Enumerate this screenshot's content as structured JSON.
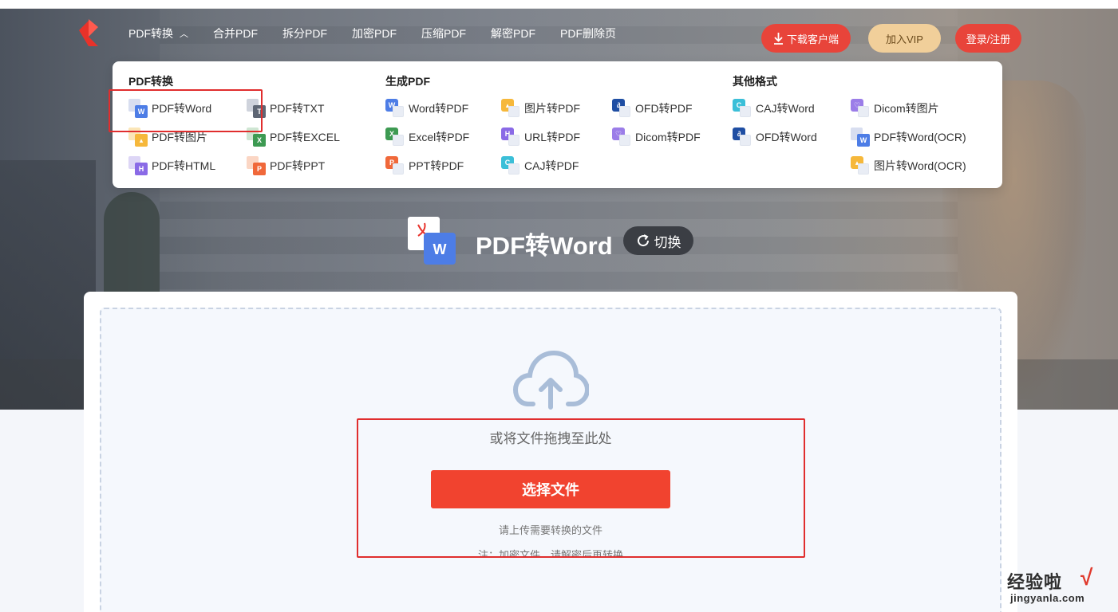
{
  "nav": {
    "items": [
      "PDF转换",
      "合并PDF",
      "拆分PDF",
      "加密PDF",
      "压缩PDF",
      "解密PDF",
      "PDF删除页"
    ],
    "download_label": "下载客户端",
    "vip_label": "加入VIP",
    "login_label": "登录/注册"
  },
  "dropdown": {
    "pdf_convert": {
      "heading": "PDF转换",
      "items": [
        "PDF转Word",
        "PDF转TXT",
        "PDF转图片",
        "PDF转EXCEL",
        "PDF转HTML",
        "PDF转PPT"
      ]
    },
    "to_pdf": {
      "heading": "生成PDF",
      "items": [
        "Word转PDF",
        "图片转PDF",
        "OFD转PDF",
        "Excel转PDF",
        "URL转PDF",
        "Dicom转PDF",
        "PPT转PDF",
        "CAJ转PDF"
      ]
    },
    "other": {
      "heading": "其他格式",
      "items": [
        "CAJ转Word",
        "Dicom转图片",
        "OFD转Word",
        "PDF转Word(OCR)",
        "图片转Word(OCR)"
      ]
    }
  },
  "page": {
    "title": "PDF转Word",
    "switch_label": "切换"
  },
  "upload": {
    "drop_text": "或将文件拖拽至此处",
    "choose_label": "选择文件",
    "hint": "请上传需要转换的文件",
    "note": "注：加密文件，请解密后再转换"
  },
  "watermark": {
    "brand": "经验啦",
    "check": "√",
    "domain": "jingyanla.com"
  },
  "colors": {
    "accent": "#f1432f",
    "vip": "#f1cf9a",
    "highlight_box": "#e02e2e"
  }
}
